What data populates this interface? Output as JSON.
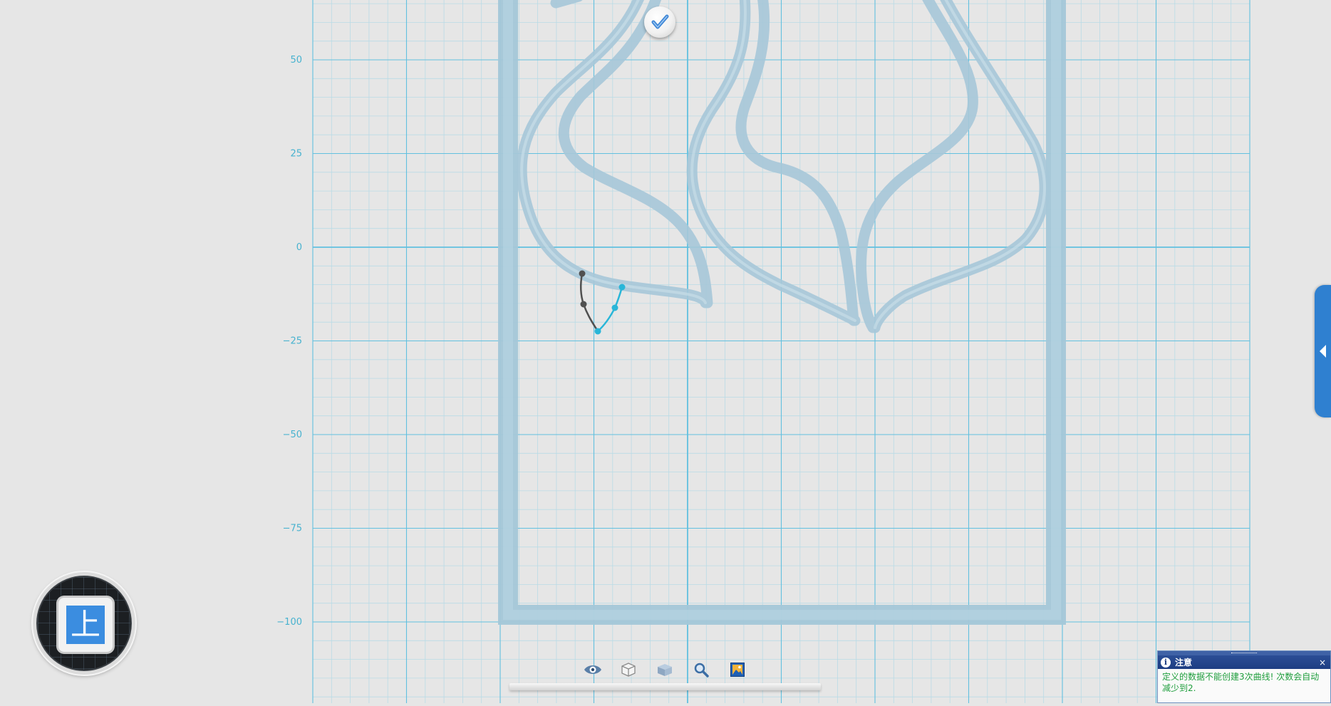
{
  "viewport": {
    "y_axis_labels": [
      "50",
      "25",
      "0",
      "−25",
      "−50",
      "−75",
      "−100"
    ],
    "colors": {
      "background": "#e6e6e6",
      "grid_minor": "#b9dbe6",
      "grid_major": "#62c0df",
      "axis_label": "#47b2cf",
      "model_stroke": "#a7c8d9",
      "curve_dark": "#505050",
      "curve_active": "#29b6d8"
    }
  },
  "confirm_button": {
    "icon": "checkmark-icon"
  },
  "view_cube": {
    "face_label": "上"
  },
  "side_panel_toggle": {
    "icon": "arrow-left-icon"
  },
  "toolbar": {
    "tools": [
      {
        "name": "view-toggle",
        "icon": "eye-icon"
      },
      {
        "name": "wireframe",
        "icon": "cube-outline-icon"
      },
      {
        "name": "solid",
        "icon": "cube-solid-icon"
      },
      {
        "name": "zoom",
        "icon": "magnifier-icon"
      },
      {
        "name": "fit-view",
        "icon": "picture-icon"
      }
    ]
  },
  "notice": {
    "title": "注意",
    "close": "×",
    "line1": "定义的数据不能创建3次曲线! 次数会自动",
    "line2": "减少到2."
  }
}
